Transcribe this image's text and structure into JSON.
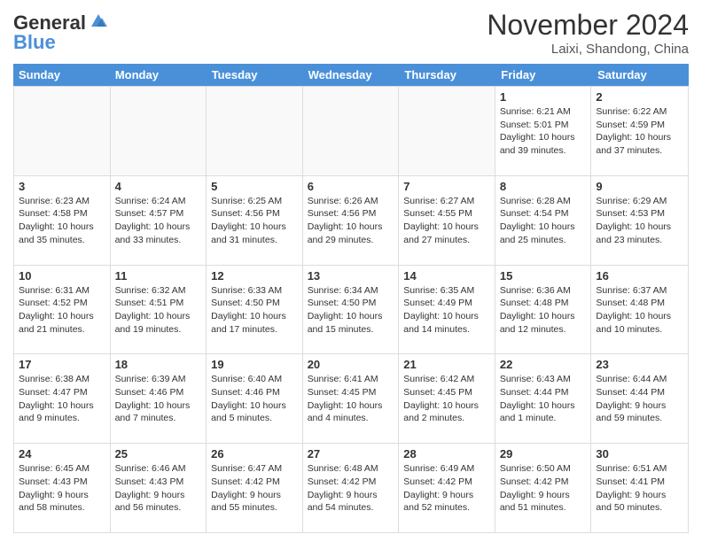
{
  "header": {
    "logo_line1": "General",
    "logo_line2": "Blue",
    "month_title": "November 2024",
    "location": "Laixi, Shandong, China"
  },
  "days_of_week": [
    "Sunday",
    "Monday",
    "Tuesday",
    "Wednesday",
    "Thursday",
    "Friday",
    "Saturday"
  ],
  "weeks": [
    [
      {
        "day": "",
        "info": ""
      },
      {
        "day": "",
        "info": ""
      },
      {
        "day": "",
        "info": ""
      },
      {
        "day": "",
        "info": ""
      },
      {
        "day": "",
        "info": ""
      },
      {
        "day": "1",
        "info": "Sunrise: 6:21 AM\nSunset: 5:01 PM\nDaylight: 10 hours and 39 minutes."
      },
      {
        "day": "2",
        "info": "Sunrise: 6:22 AM\nSunset: 4:59 PM\nDaylight: 10 hours and 37 minutes."
      }
    ],
    [
      {
        "day": "3",
        "info": "Sunrise: 6:23 AM\nSunset: 4:58 PM\nDaylight: 10 hours and 35 minutes."
      },
      {
        "day": "4",
        "info": "Sunrise: 6:24 AM\nSunset: 4:57 PM\nDaylight: 10 hours and 33 minutes."
      },
      {
        "day": "5",
        "info": "Sunrise: 6:25 AM\nSunset: 4:56 PM\nDaylight: 10 hours and 31 minutes."
      },
      {
        "day": "6",
        "info": "Sunrise: 6:26 AM\nSunset: 4:56 PM\nDaylight: 10 hours and 29 minutes."
      },
      {
        "day": "7",
        "info": "Sunrise: 6:27 AM\nSunset: 4:55 PM\nDaylight: 10 hours and 27 minutes."
      },
      {
        "day": "8",
        "info": "Sunrise: 6:28 AM\nSunset: 4:54 PM\nDaylight: 10 hours and 25 minutes."
      },
      {
        "day": "9",
        "info": "Sunrise: 6:29 AM\nSunset: 4:53 PM\nDaylight: 10 hours and 23 minutes."
      }
    ],
    [
      {
        "day": "10",
        "info": "Sunrise: 6:31 AM\nSunset: 4:52 PM\nDaylight: 10 hours and 21 minutes."
      },
      {
        "day": "11",
        "info": "Sunrise: 6:32 AM\nSunset: 4:51 PM\nDaylight: 10 hours and 19 minutes."
      },
      {
        "day": "12",
        "info": "Sunrise: 6:33 AM\nSunset: 4:50 PM\nDaylight: 10 hours and 17 minutes."
      },
      {
        "day": "13",
        "info": "Sunrise: 6:34 AM\nSunset: 4:50 PM\nDaylight: 10 hours and 15 minutes."
      },
      {
        "day": "14",
        "info": "Sunrise: 6:35 AM\nSunset: 4:49 PM\nDaylight: 10 hours and 14 minutes."
      },
      {
        "day": "15",
        "info": "Sunrise: 6:36 AM\nSunset: 4:48 PM\nDaylight: 10 hours and 12 minutes."
      },
      {
        "day": "16",
        "info": "Sunrise: 6:37 AM\nSunset: 4:48 PM\nDaylight: 10 hours and 10 minutes."
      }
    ],
    [
      {
        "day": "17",
        "info": "Sunrise: 6:38 AM\nSunset: 4:47 PM\nDaylight: 10 hours and 9 minutes."
      },
      {
        "day": "18",
        "info": "Sunrise: 6:39 AM\nSunset: 4:46 PM\nDaylight: 10 hours and 7 minutes."
      },
      {
        "day": "19",
        "info": "Sunrise: 6:40 AM\nSunset: 4:46 PM\nDaylight: 10 hours and 5 minutes."
      },
      {
        "day": "20",
        "info": "Sunrise: 6:41 AM\nSunset: 4:45 PM\nDaylight: 10 hours and 4 minutes."
      },
      {
        "day": "21",
        "info": "Sunrise: 6:42 AM\nSunset: 4:45 PM\nDaylight: 10 hours and 2 minutes."
      },
      {
        "day": "22",
        "info": "Sunrise: 6:43 AM\nSunset: 4:44 PM\nDaylight: 10 hours and 1 minute."
      },
      {
        "day": "23",
        "info": "Sunrise: 6:44 AM\nSunset: 4:44 PM\nDaylight: 9 hours and 59 minutes."
      }
    ],
    [
      {
        "day": "24",
        "info": "Sunrise: 6:45 AM\nSunset: 4:43 PM\nDaylight: 9 hours and 58 minutes."
      },
      {
        "day": "25",
        "info": "Sunrise: 6:46 AM\nSunset: 4:43 PM\nDaylight: 9 hours and 56 minutes."
      },
      {
        "day": "26",
        "info": "Sunrise: 6:47 AM\nSunset: 4:42 PM\nDaylight: 9 hours and 55 minutes."
      },
      {
        "day": "27",
        "info": "Sunrise: 6:48 AM\nSunset: 4:42 PM\nDaylight: 9 hours and 54 minutes."
      },
      {
        "day": "28",
        "info": "Sunrise: 6:49 AM\nSunset: 4:42 PM\nDaylight: 9 hours and 52 minutes."
      },
      {
        "day": "29",
        "info": "Sunrise: 6:50 AM\nSunset: 4:42 PM\nDaylight: 9 hours and 51 minutes."
      },
      {
        "day": "30",
        "info": "Sunrise: 6:51 AM\nSunset: 4:41 PM\nDaylight: 9 hours and 50 minutes."
      }
    ]
  ]
}
